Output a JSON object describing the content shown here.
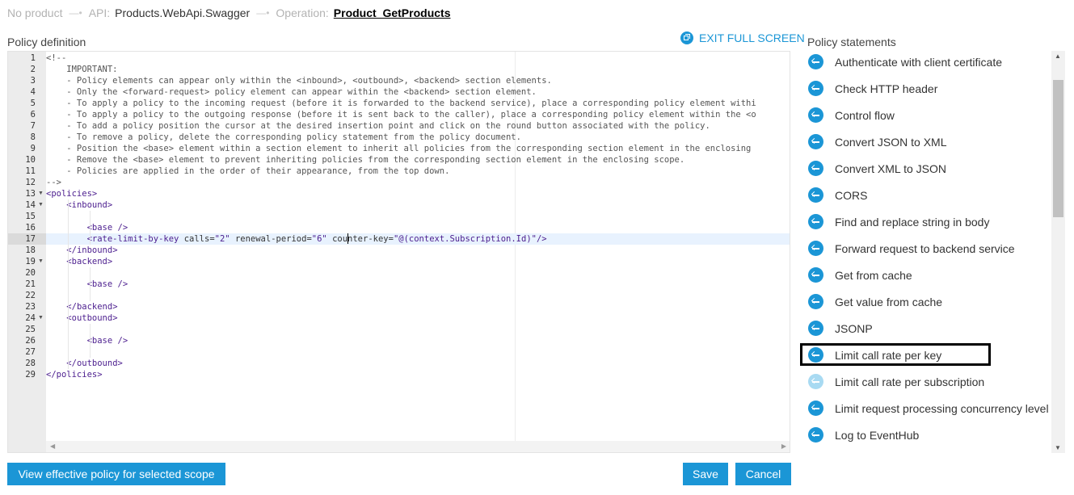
{
  "breadcrumb": {
    "product": "No product",
    "api_prefix": "API:",
    "api_name": "Products.WebApi.Swagger",
    "op_prefix": "Operation:",
    "op_name": "Product_GetProducts"
  },
  "editor": {
    "label": "Policy definition",
    "exit_fullscreen": "EXIT FULL SCREEN",
    "active_line": 17,
    "lines": [
      "<!--",
      "    IMPORTANT:",
      "    - Policy elements can appear only within the <inbound>, <outbound>, <backend> section elements.",
      "    - Only the <forward-request> policy element can appear within the <backend> section element.",
      "    - To apply a policy to the incoming request (before it is forwarded to the backend service), place a corresponding policy element withi",
      "    - To apply a policy to the outgoing response (before it is sent back to the caller), place a corresponding policy element within the <o",
      "    - To add a policy position the cursor at the desired insertion point and click on the round button associated with the policy.",
      "    - To remove a policy, delete the corresponding policy statement from the policy document.",
      "    - Position the <base> element within a section element to inherit all policies from the corresponding section element in the enclosing",
      "    - Remove the <base> element to prevent inheriting policies from the corresponding section element in the enclosing scope.",
      "    - Policies are applied in the order of their appearance, from the top down.",
      "-->",
      "<policies>",
      "    <inbound>",
      "",
      "        <base />",
      "        <rate-limit-by-key calls=\"2\" renewal-period=\"6\" counter-key=\"@(context.Subscription.Id)\"/>",
      "    </inbound>",
      "    <backend>",
      "",
      "        <base />",
      "",
      "    </backend>",
      "    <outbound>",
      "",
      "        <base />",
      "",
      "    </outbound>",
      "</policies>"
    ],
    "fold_lines": [
      13,
      14,
      19,
      24
    ]
  },
  "buttons": {
    "view_effective": "View effective policy for selected scope",
    "save": "Save",
    "cancel": "Cancel"
  },
  "statements": {
    "label": "Policy statements",
    "highlighted": "Limit call rate per key",
    "items": [
      {
        "label": "Authenticate with client certificate",
        "enabled": true
      },
      {
        "label": "Check HTTP header",
        "enabled": true
      },
      {
        "label": "Control flow",
        "enabled": true
      },
      {
        "label": "Convert JSON to XML",
        "enabled": true
      },
      {
        "label": "Convert XML to JSON",
        "enabled": true
      },
      {
        "label": "CORS",
        "enabled": true
      },
      {
        "label": "Find and replace string in body",
        "enabled": true
      },
      {
        "label": "Forward request to backend service",
        "enabled": true
      },
      {
        "label": "Get from cache",
        "enabled": true
      },
      {
        "label": "Get value from cache",
        "enabled": true
      },
      {
        "label": "JSONP",
        "enabled": true
      },
      {
        "label": "Limit call rate per key",
        "enabled": true
      },
      {
        "label": "Limit call rate per subscription",
        "enabled": false
      },
      {
        "label": "Limit request processing concurrency level",
        "enabled": true
      },
      {
        "label": "Log to EventHub",
        "enabled": true
      }
    ]
  },
  "colors": {
    "accent": "#1b96d6",
    "accent_disabled": "#a8daf2",
    "tag": "#4b1d8e"
  }
}
